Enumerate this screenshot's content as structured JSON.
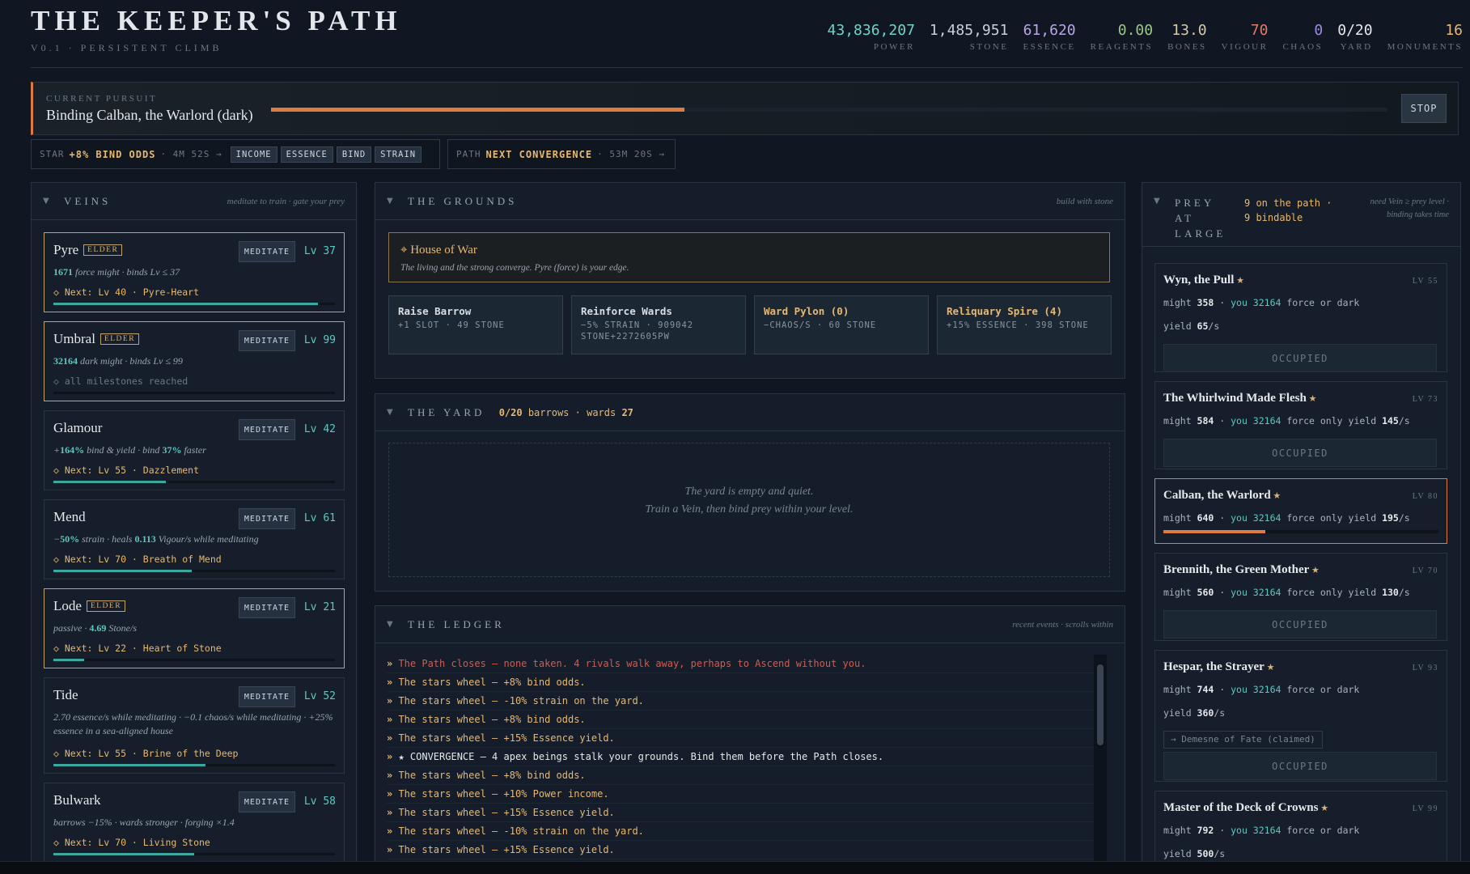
{
  "header": {
    "title": "THE KEEPER'S PATH",
    "subtitle": "V0.1 · PERSISTENT CLIMB",
    "stats": [
      {
        "value": "43,836,207",
        "label": "POWER",
        "color": "#6fd3c7"
      },
      {
        "value": "1,485,951",
        "label": "STONE",
        "color": "#c9d0d8"
      },
      {
        "value": "61,620",
        "label": "ESSENCE",
        "color": "#b9a6e8"
      },
      {
        "value": "0.00",
        "label": "REAGENTS",
        "color": "#9cc78a"
      },
      {
        "value": "13.0",
        "label": "BONES",
        "color": "#d8c9a8"
      },
      {
        "value": "70",
        "label": "VIGOUR",
        "color": "#e07a6a"
      },
      {
        "value": "0",
        "label": "CHAOS",
        "color": "#9c8ae0"
      },
      {
        "value": "0/20",
        "label": "YARD",
        "color": "#e6e9ec"
      },
      {
        "value": "16",
        "label": "MONUMENTS",
        "color": "#e7b872"
      }
    ]
  },
  "pursuit": {
    "caption": "CURRENT PURSUIT",
    "name": "Binding Calban, the Warlord (dark)",
    "progress": 0.37,
    "stop_label": "STOP"
  },
  "star": {
    "key": "STAR",
    "bonus": "+8% BIND ODDS",
    "time": "· 4M 52S →",
    "chips": [
      "INCOME",
      "ESSENCE",
      "BIND",
      "STRAIN"
    ]
  },
  "path": {
    "key": "PATH",
    "label": "NEXT CONVERGENCE",
    "time": "· 53M 20S →"
  },
  "veins": {
    "title": "VEINS",
    "hint": "meditate to train · gate your prey",
    "meditate_label": "MEDITATE",
    "items": [
      {
        "name": "Pyre",
        "badge": "ELDER",
        "level": "Lv 37",
        "desc_num": "1671",
        "desc": " force might · binds Lv ≤ 37",
        "next": "◇ Next: Lv 40 · Pyre-Heart",
        "progress": 0.94
      },
      {
        "name": "Umbral",
        "badge": "ELDER",
        "level": "Lv 99",
        "desc_num": "32164",
        "desc": " dark might · binds Lv ≤ 99",
        "next": "◇ all milestones reached",
        "progress": 0
      },
      {
        "name": "Glamour",
        "badge": "",
        "level": "Lv 42",
        "desc_pre": "+",
        "desc_num": "164%",
        "desc": " bind & yield · bind ",
        "desc_num2": "37%",
        "desc2": " faster",
        "next": "◇ Next: Lv 55 · Dazzlement",
        "progress": 0.4
      },
      {
        "name": "Mend",
        "badge": "",
        "level": "Lv 61",
        "desc_pre": "−",
        "desc_num": "50%",
        "desc": " strain · heals ",
        "desc_num2": "0.113",
        "desc2": " Vigour/s while meditating",
        "next": "◇ Next: Lv 70 · Breath of Mend",
        "progress": 0.49
      },
      {
        "name": "Lode",
        "badge": "ELDER",
        "level": "Lv 21",
        "desc": "passive · ",
        "desc_num2": "4.69",
        "desc2": " Stone/s",
        "next": "◇ Next: Lv 22 · Heart of Stone",
        "progress": 0.11
      },
      {
        "name": "Tide",
        "badge": "",
        "level": "Lv 52",
        "desc": "2.70 essence/s while meditating · −0.1 chaos/s while meditating · +25% essence in a sea-aligned house",
        "next": "◇ Next: Lv 55 · Brine of the Deep",
        "progress": 0.54
      },
      {
        "name": "Bulwark",
        "badge": "",
        "level": "Lv 58",
        "desc": "barrows −15% · wards stronger · forging ×1.4",
        "next": "◇ Next: Lv 70 · Living Stone",
        "progress": 0.5
      }
    ]
  },
  "grounds": {
    "title": "THE GROUNDS",
    "hint": "build with stone",
    "house_name": "⌖ House of War",
    "house_desc": "The living and the strong converge. Pyre (force) is your edge.",
    "builds": [
      {
        "title": "Raise Barrow",
        "sub": "+1 SLOT · 49 STONE",
        "gold": false
      },
      {
        "title": "Reinforce Wards",
        "sub": "−5% STRAIN · 909042 STONE+2272605PW",
        "gold": false
      },
      {
        "title": "Ward Pylon (0)",
        "sub": "−CHAOS/S · 60 STONE",
        "gold": true
      },
      {
        "title": "Reliquary Spire (4)",
        "sub": "+15% ESSENCE · 398 STONE",
        "gold": true
      }
    ]
  },
  "yard": {
    "title": "THE YARD",
    "count": "0/20",
    "barrows_label": "barrows ·",
    "wards_label": "wards",
    "wards": "27",
    "empty_1": "The yard is empty and quiet.",
    "empty_2": "Train a Vein, then bind prey within your level."
  },
  "ledger": {
    "title": "THE LEDGER",
    "hint": "recent events · scrolls within",
    "lines": [
      {
        "text": "The Path closes — none taken. 4 rivals walk away, perhaps to Ascend without you.",
        "tone": "red"
      },
      {
        "text": "The stars wheel — +8% bind odds.",
        "tone": "gold"
      },
      {
        "text": "The stars wheel — -10% strain on the yard.",
        "tone": "gold"
      },
      {
        "text": "The stars wheel — +8% bind odds.",
        "tone": "gold"
      },
      {
        "text": "The stars wheel — +15% Essence yield.",
        "tone": "gold"
      },
      {
        "text": "★ CONVERGENCE — 4 apex beings stalk your grounds. Bind them before the Path closes.",
        "tone": "white"
      },
      {
        "text": "The stars wheel — +8% bind odds.",
        "tone": "gold"
      },
      {
        "text": "The stars wheel — +10% Power income.",
        "tone": "gold"
      },
      {
        "text": "The stars wheel — +15% Essence yield.",
        "tone": "gold"
      },
      {
        "text": "The stars wheel — -10% strain on the yard.",
        "tone": "gold"
      },
      {
        "text": "The stars wheel — +15% Essence yield.",
        "tone": "gold"
      }
    ]
  },
  "prey": {
    "title": "PREY AT LARGE",
    "summary": "9 on the path · 9 bindable",
    "hint": "need Vein ≥ prey level · binding takes time",
    "occupied_label": "OCCUPIED",
    "items": [
      {
        "name": "Wyn, the Pull",
        "level": "LV 55",
        "might": "358",
        "you": "32164",
        "mode": "force or dark",
        "yield": "65"
      },
      {
        "name": "The Whirlwind Made Flesh",
        "level": "LV 73",
        "might": "584",
        "you": "32164",
        "mode": "force only",
        "yield": "145"
      },
      {
        "name": "Calban, the Warlord",
        "level": "LV 80",
        "might": "640",
        "you": "32164",
        "mode": "force only",
        "yield": "195",
        "progress": 0.37
      },
      {
        "name": "Brennith, the Green Mother",
        "level": "LV 70",
        "might": "560",
        "you": "32164",
        "mode": "force only",
        "yield": "130"
      },
      {
        "name": "Hespar, the Strayer",
        "level": "LV 93",
        "might": "744",
        "you": "32164",
        "mode": "force or dark",
        "yield": "360",
        "claim": "→ Demesne of Fate (claimed)"
      },
      {
        "name": "Master of the Deck of Crowns",
        "level": "LV 99",
        "might": "792",
        "you": "32164",
        "mode": "force or dark",
        "yield": "500"
      }
    ]
  }
}
